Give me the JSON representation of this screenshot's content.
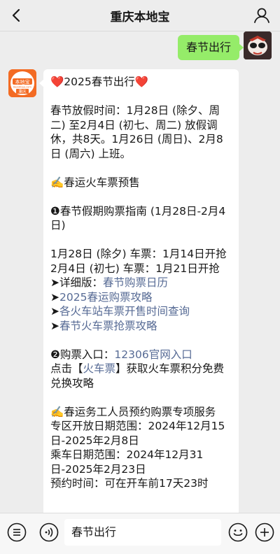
{
  "header": {
    "title": "重庆本地宝"
  },
  "chat": {
    "outgoing_message": "春节出行",
    "bot_avatar_text": {
      "top": "本地宝",
      "url": "Bendibao.com",
      "city": "重庆"
    },
    "incoming": [
      [
        {
          "t": "❤️2025春节出行❤️"
        }
      ],
      [],
      [
        {
          "t": "春节放假时间：1月28日 (除夕、周二) 至2月4日 (初七、周二) 放假调休，共8天。1月26日 (周日)、2月8日 (周六) 上班。"
        }
      ],
      [],
      [
        {
          "t": "✍️春运火车票预售"
        }
      ],
      [],
      [
        {
          "t": "❶春节假期购票指南 (1月28日-2月4日)"
        }
      ],
      [],
      [
        {
          "t": "1月28日 (除夕) 车票：1月14日开抢"
        }
      ],
      [
        {
          "t": "2月4日 (初七) 车票：1月21日开抢"
        }
      ],
      [
        {
          "t": "➤详细版："
        },
        {
          "t": "春节购票日历",
          "link": true
        }
      ],
      [
        {
          "t": "➤"
        },
        {
          "t": "2025春运购票攻略",
          "link": true
        }
      ],
      [
        {
          "t": "➤"
        },
        {
          "t": "各火车站车票开售时间查询",
          "link": true
        }
      ],
      [
        {
          "t": "➤"
        },
        {
          "t": "春节火车票抢票攻略",
          "link": true
        }
      ],
      [],
      [
        {
          "t": "❷购票入口："
        },
        {
          "t": "12306官网入口",
          "link": true
        }
      ],
      [
        {
          "t": "点击【"
        },
        {
          "t": "火车票",
          "link": true
        },
        {
          "t": "】获取火车票积分免费兑换攻略"
        }
      ],
      [],
      [
        {
          "t": "✍️春运务工人员预约购票专项服务"
        }
      ],
      [
        {
          "t": "专区开放日期范围：2024年12月15日-2025年2月8日"
        }
      ],
      [
        {
          "t": "乘车日期范围：2024年12月31日-2025年2月23日"
        }
      ],
      [
        {
          "t": "预约时间：可在开车前17天23时"
        }
      ]
    ]
  },
  "input_bar": {
    "text": "春节出行"
  },
  "colors": {
    "outgoing_bubble": "#95ec69",
    "link": "#576b95",
    "avatar_bg": "#f36b23"
  }
}
